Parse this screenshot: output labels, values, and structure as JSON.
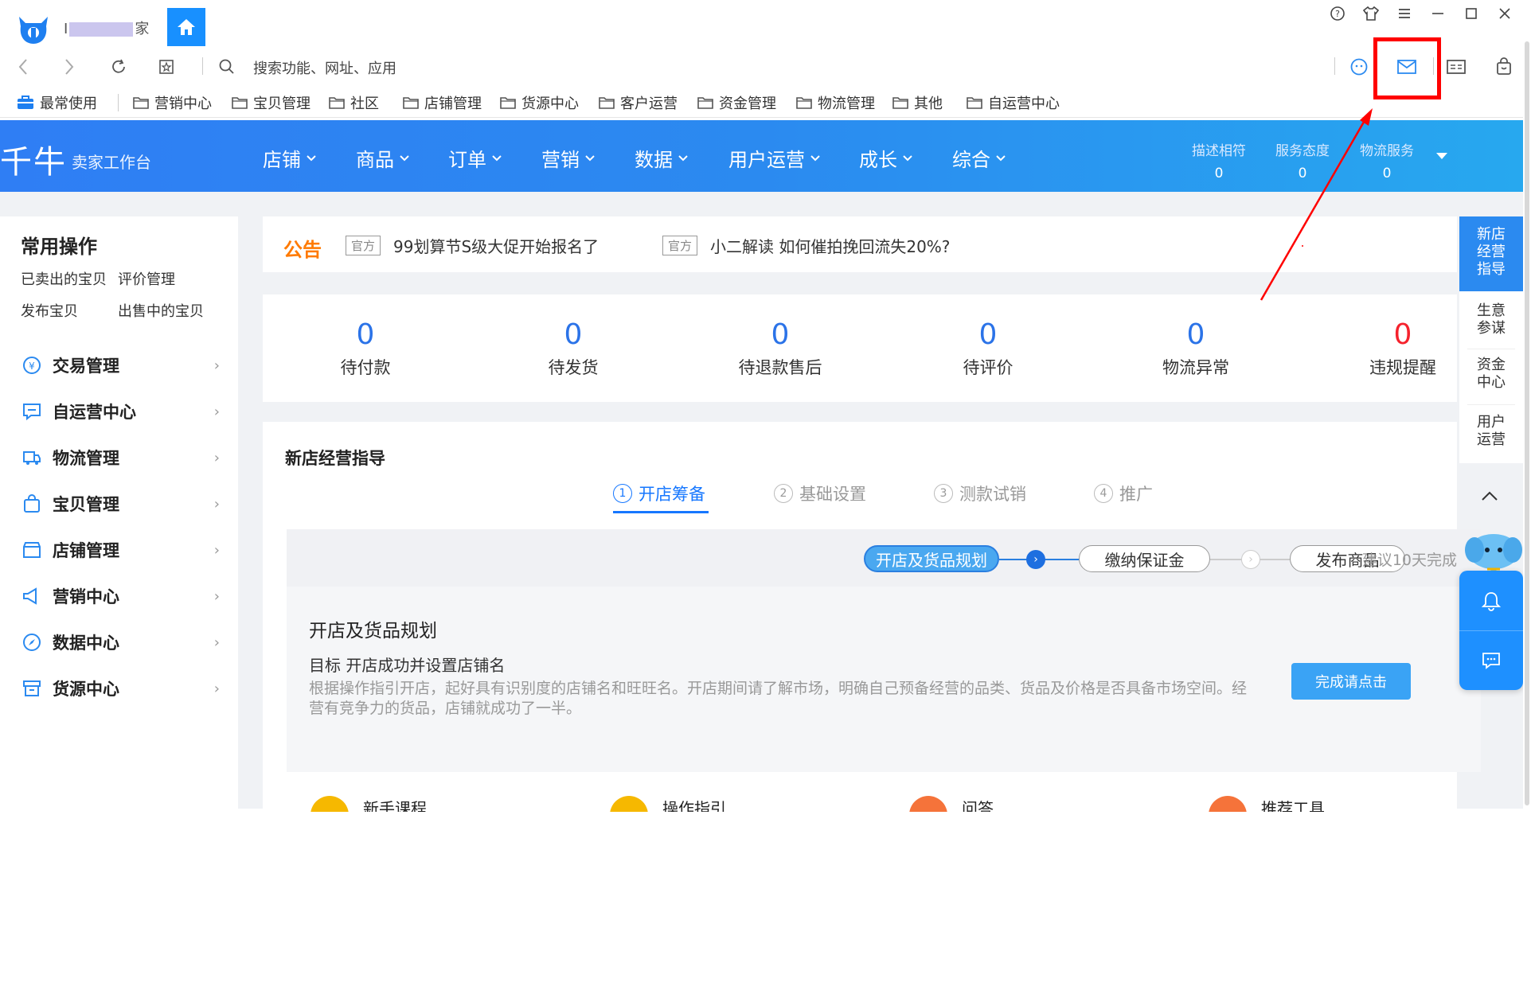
{
  "titlebar": {
    "user_prefix": "I",
    "user_suffix": "家"
  },
  "address": {
    "placeholder": "搜索功能、网址、应用"
  },
  "bookmarks": [
    "最常使用",
    "营销中心",
    "宝贝管理",
    "社区",
    "店铺管理",
    "货源中心",
    "客户运营",
    "资金管理",
    "物流管理",
    "其他",
    "自运营中心"
  ],
  "header": {
    "brand": "千牛",
    "brand_sub": "卖家工作台",
    "menu": [
      "店铺",
      "商品",
      "订单",
      "营销",
      "数据",
      "用户运营",
      "成长",
      "综合"
    ],
    "scores": [
      {
        "label": "描述相符",
        "value": "0"
      },
      {
        "label": "服务态度",
        "value": "0"
      },
      {
        "label": "物流服务",
        "value": "0"
      }
    ]
  },
  "sidebar": {
    "title": "常用操作",
    "quick": [
      "已卖出的宝贝",
      "评价管理",
      "发布宝贝",
      "出售中的宝贝"
    ],
    "items": [
      "交易管理",
      "自运营中心",
      "物流管理",
      "宝贝管理",
      "店铺管理",
      "营销中心",
      "数据中心",
      "货源中心"
    ]
  },
  "notice": {
    "title": "公告",
    "items": [
      {
        "tag": "官方",
        "text": "99划算节S级大促开始报名了"
      },
      {
        "tag": "官方",
        "text": "小二解读 如何催拍挽回流失20%?"
      }
    ]
  },
  "stats": [
    {
      "value": "0",
      "label": "待付款"
    },
    {
      "value": "0",
      "label": "待发货"
    },
    {
      "value": "0",
      "label": "待退款售后"
    },
    {
      "value": "0",
      "label": "待评价"
    },
    {
      "value": "0",
      "label": "物流异常"
    },
    {
      "value": "0",
      "label": "违规提醒"
    }
  ],
  "colors": {
    "stat_value": "#2b73e8",
    "stat_alert": "#f5222d",
    "brand_blue": "#2b8af0",
    "notice_orange": "#ff7a00",
    "highlight_red": "#ff0000"
  },
  "guide": {
    "title": "新店经营指导",
    "steps": [
      {
        "num": "1",
        "label": "开店筹备"
      },
      {
        "num": "2",
        "label": "基础设置"
      },
      {
        "num": "3",
        "label": "测款试销"
      },
      {
        "num": "4",
        "label": "推广"
      }
    ],
    "sub_steps": [
      "开店及货品规划",
      "缴纳保证金",
      "发布商品"
    ],
    "suggest": "建议10天完成",
    "heading": "开店及货品规划",
    "goal": "目标 开店成功并设置店铺名",
    "desc": "根据操作指引开店，起好具有识别度的店铺名和旺旺名。开店期间请了解市场，明确自己预备经营的品类、货品及价格是否具备市场空间。经营有竞争力的货品，店铺就成功了一半。",
    "done_btn": "完成请点击",
    "tools": [
      "新手课程",
      "操作指引",
      "问答",
      "推荐工具"
    ]
  },
  "right_panel": {
    "items": [
      [
        "新店",
        "经营",
        "指导"
      ],
      [
        "生意",
        "参谋"
      ],
      [
        "资金",
        "中心"
      ],
      [
        "用户",
        "运营"
      ]
    ]
  }
}
